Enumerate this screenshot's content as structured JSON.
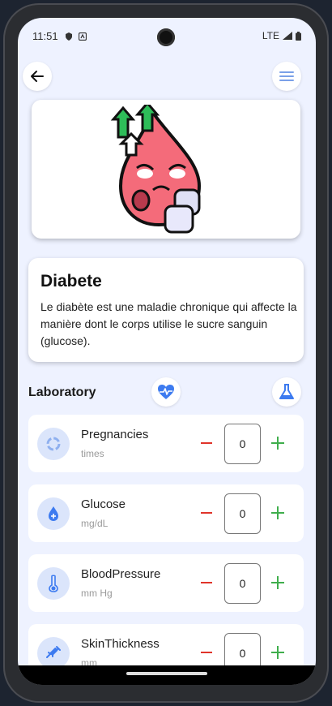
{
  "status_bar": {
    "time": "11:51",
    "network": "LTE"
  },
  "header": {
    "back_icon": "arrow-left-icon",
    "menu_icon": "menu-icon"
  },
  "disease": {
    "title": "Diabete",
    "description": "Le diabète est une maladie chronique qui affecte la manière dont le corps utilise le sucre sanguin (glucose)."
  },
  "laboratory": {
    "title": "Laboratory",
    "items": [
      {
        "name": "Pregnancies",
        "unit": "times",
        "value": "0",
        "icon": "loading-circle-icon"
      },
      {
        "name": "Glucose",
        "unit": "mg/dL",
        "value": "0",
        "icon": "drop-icon"
      },
      {
        "name": "BloodPressure",
        "unit": "mm Hg",
        "value": "0",
        "icon": "thermometer-icon"
      },
      {
        "name": "SkinThickness",
        "unit": "mm",
        "value": "0",
        "icon": "syringe-icon"
      }
    ]
  },
  "colors": {
    "accent": "#3d7bf0",
    "minus": "#e0342a",
    "plus": "#3fae4c",
    "background": "#eef2ff"
  }
}
